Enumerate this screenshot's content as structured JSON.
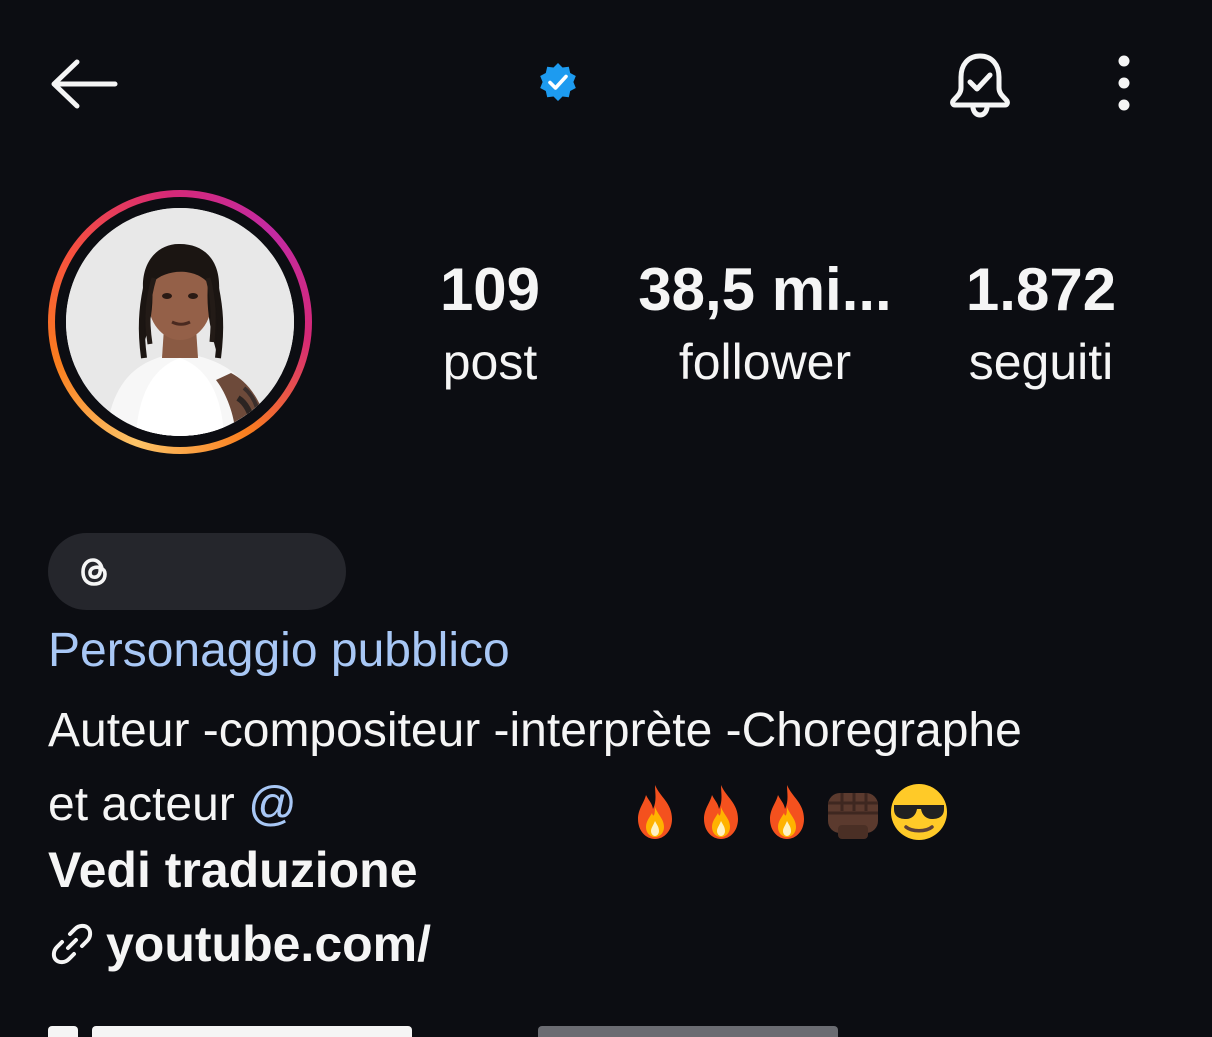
{
  "header": {
    "back_icon": "arrow-left-icon",
    "verified_icon": "verified-badge-icon",
    "verified_color": "#1d9bf0",
    "bell_icon": "bell-check-icon",
    "more_icon": "more-vertical-icon"
  },
  "profile": {
    "avatar_icon": "profile-photo",
    "story_ring_colors": [
      "#fdc468",
      "#fa7e1e",
      "#d62976",
      "#c32aa3"
    ]
  },
  "stats": [
    {
      "value": "109",
      "label": "post"
    },
    {
      "value": "38,5 mi...",
      "label": "follower"
    },
    {
      "value": "1.872",
      "label": "seguiti"
    }
  ],
  "threads": {
    "icon": "threads-icon"
  },
  "category": "Personaggio pubblico",
  "bio": {
    "line1": "Auteur -compositeur -interprète -Choregraphe",
    "line2_prefix": "et acteur ",
    "mention": "@",
    "emojis": [
      "fire",
      "fire",
      "fire",
      "fist-dark-skin",
      "sunglasses-face"
    ]
  },
  "see_translation": "Vedi traduzione",
  "link": {
    "icon": "link-icon",
    "text": "youtube.com/"
  },
  "accent_color": "#a8c7f5",
  "background_color": "#0c0d12"
}
